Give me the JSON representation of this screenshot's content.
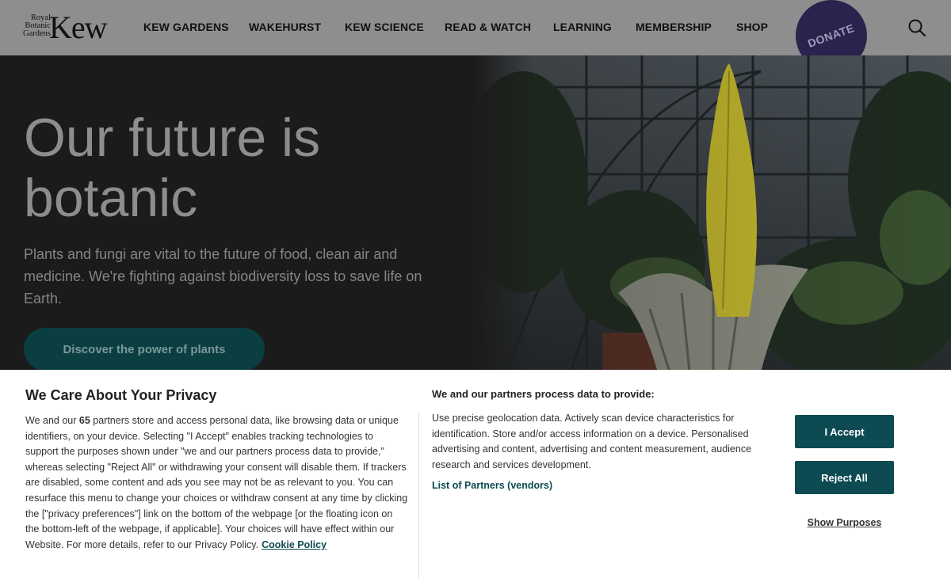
{
  "header": {
    "logo": {
      "line1": "Royal",
      "line2": "Botanic",
      "line3": "Gardens",
      "wordmark": "Kew"
    },
    "nav": [
      {
        "label": "KEW GARDENS"
      },
      {
        "label": "WAKEHURST"
      },
      {
        "label": "KEW SCIENCE"
      },
      {
        "label": "READ & WATCH"
      },
      {
        "label": "LEARNING"
      },
      {
        "label": "MEMBERSHIP"
      },
      {
        "label": "SHOP"
      }
    ],
    "donate_label": "DONATE",
    "search_icon": "search-icon"
  },
  "hero": {
    "title_line1": "Our future is",
    "title_line2": "botanic",
    "text": "Plants and fungi are vital to the future of food, clean air and medicine. We're fighting against biodiversity loss to save life on Earth.",
    "button_label": "Discover the power of plants"
  },
  "consent": {
    "title": "We Care About Your Privacy",
    "body_prefix": "We and our ",
    "partner_count": "65",
    "body_suffix": " partners store and access personal data, like browsing data or unique identifiers, on your device. Selecting \"I Accept\" enables tracking technologies to support the purposes shown under \"we and our partners process data to provide,\" whereas selecting \"Reject All\" or withdrawing your consent will disable them. If trackers are disabled, some content and ads you see may not be as relevant to you. You can resurface this menu to change your choices or withdraw consent at any time by clicking the [\"privacy preferences\"] link on the bottom of the webpage [or the floating icon on the bottom-left of the webpage, if applicable]. Your choices will have effect within our Website. For more details, refer to our Privacy Policy.",
    "cookie_policy_label": "Cookie Policy",
    "subtitle": "We and our partners process data to provide:",
    "purposes_text": "Use precise geolocation data. Actively scan device characteristics for identification. Store and/or access information on a device. Personalised advertising and content, advertising and content measurement, audience research and services development.",
    "partners_link": "List of Partners (vendors)",
    "accept_label": "I Accept",
    "reject_label": "Reject All",
    "show_purposes_label": "Show Purposes"
  },
  "colors": {
    "header_bg": "#8e8e8e",
    "donate_bg": "#2b224e",
    "hero_button_bg": "#0b3e40",
    "accent": "#0d4a52"
  }
}
